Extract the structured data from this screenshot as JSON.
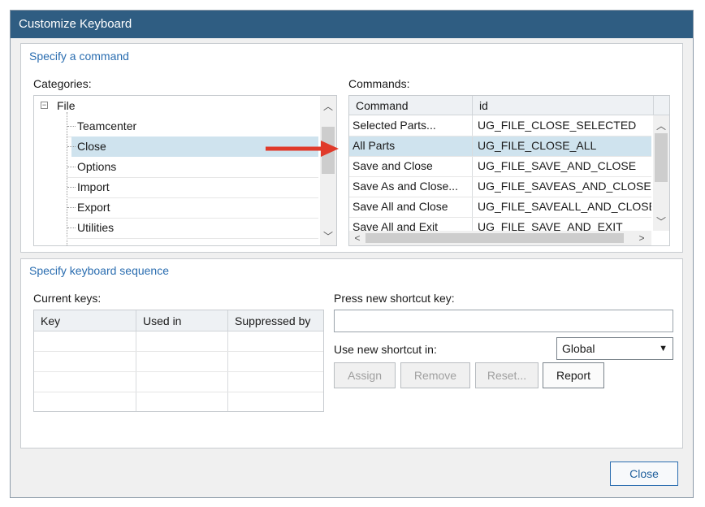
{
  "window": {
    "title": "Customize Keyboard"
  },
  "command_group": {
    "title": "Specify a command",
    "categories_label": "Categories:",
    "commands_label": "Commands:",
    "tree": {
      "root": "File",
      "children": [
        "Teamcenter",
        "Close",
        "Options",
        "Import",
        "Export",
        "Utilities"
      ],
      "selected": "Close"
    },
    "commands": {
      "headers": [
        "Command",
        "id"
      ],
      "rows": [
        {
          "command": "Selected Parts...",
          "id": "UG_FILE_CLOSE_SELECTED"
        },
        {
          "command": "All Parts",
          "id": "UG_FILE_CLOSE_ALL"
        },
        {
          "command": "Save and Close",
          "id": "UG_FILE_SAVE_AND_CLOSE"
        },
        {
          "command": "Save As and Close...",
          "id": "UG_FILE_SAVEAS_AND_CLOSE"
        },
        {
          "command": "Save All and Close",
          "id": "UG_FILE_SAVEALL_AND_CLOSE"
        },
        {
          "command": "Save All and Exit",
          "id": "UG_FILE_SAVE_AND_EXIT"
        }
      ],
      "selected": "All Parts"
    },
    "annotation_arrow_color": "#e03a2a"
  },
  "keyboard_group": {
    "title": "Specify keyboard sequence",
    "current_keys_label": "Current keys:",
    "keys_headers": [
      "Key",
      "Used in",
      "Suppressed by"
    ],
    "press_label": "Press new shortcut key:",
    "shortcut_value": "",
    "use_in_label": "Use new shortcut in:",
    "use_in_value": "Global",
    "buttons": {
      "assign": "Assign",
      "remove": "Remove",
      "reset": "Reset...",
      "report": "Report"
    }
  },
  "footer": {
    "close": "Close"
  },
  "colors": {
    "titlebar": "#2f5d82",
    "selection": "#cfe3ee",
    "group_title": "#2a6db0"
  }
}
